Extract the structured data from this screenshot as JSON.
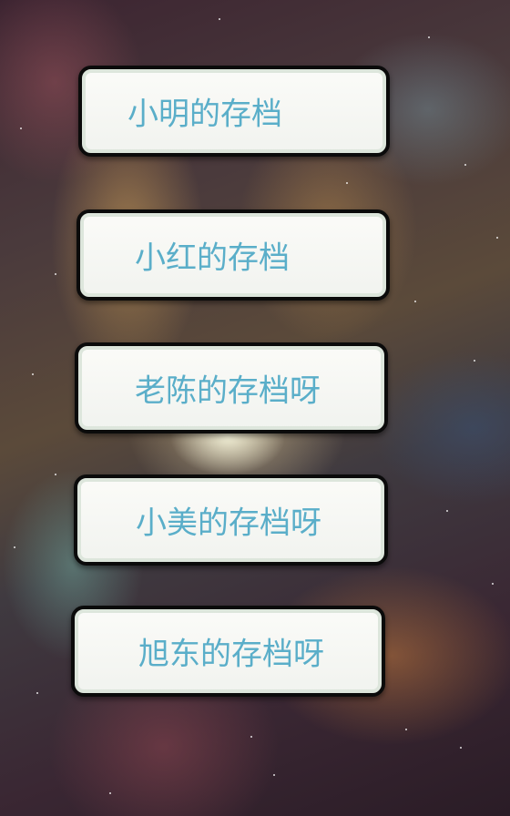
{
  "save_slots": [
    {
      "label": "小明的存档"
    },
    {
      "label": "小红的存档"
    },
    {
      "label": "老陈的存档呀"
    },
    {
      "label": "小美的存档呀"
    },
    {
      "label": "旭东的存档呀"
    }
  ],
  "colors": {
    "slot_text": "#5aaec9",
    "slot_border": "#0b0b0b",
    "slot_fill": "#f6f7f4"
  },
  "background_image": "nebula-space"
}
